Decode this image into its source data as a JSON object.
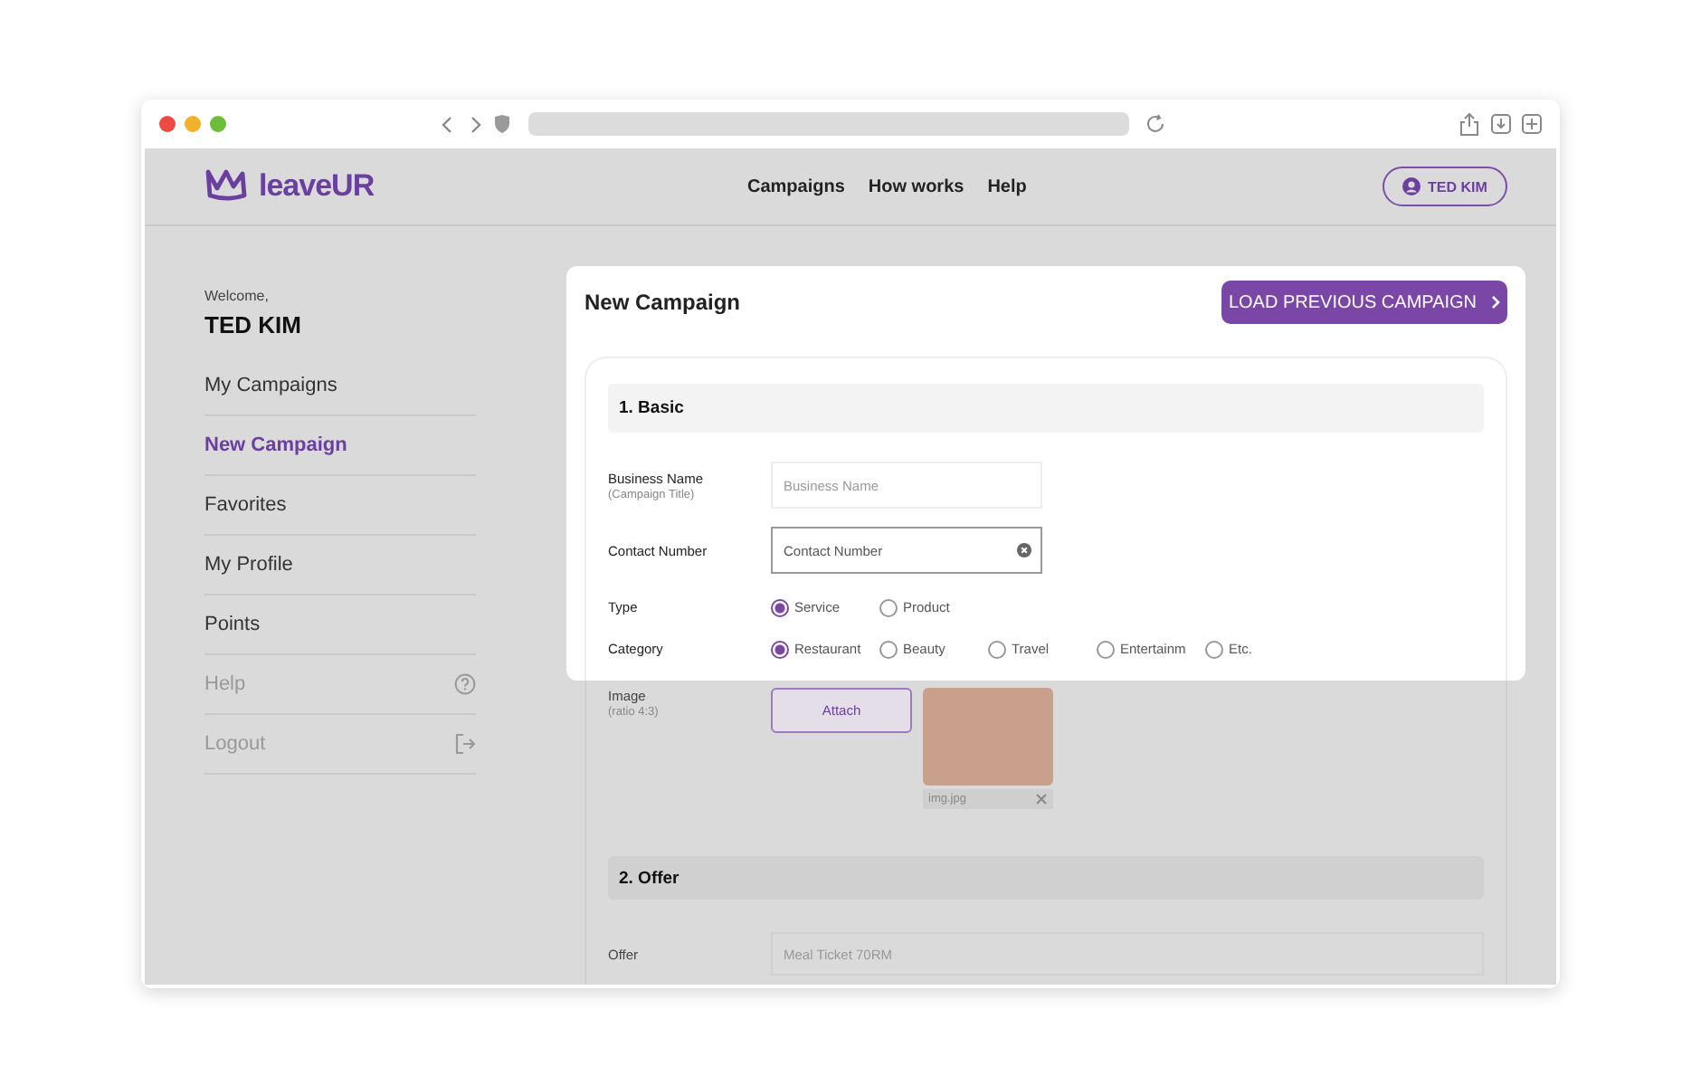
{
  "header": {
    "logo": "leaveUR",
    "nav": [
      "Campaigns",
      "How works",
      "Help"
    ],
    "user_button": "TED KIM"
  },
  "sidebar": {
    "welcome": "Welcome,",
    "user_name": "TED KIM",
    "items": [
      {
        "label": "My Campaigns",
        "kind": "nav",
        "selected": false
      },
      {
        "label": "New Campaign",
        "kind": "nav",
        "selected": true
      },
      {
        "label": "Favorites",
        "kind": "nav",
        "selected": false
      },
      {
        "label": "My Profile",
        "kind": "nav",
        "selected": false
      },
      {
        "label": "Points",
        "kind": "nav",
        "selected": false
      },
      {
        "label": "Help",
        "kind": "help",
        "selected": false
      },
      {
        "label": "Logout",
        "kind": "logout",
        "selected": false
      }
    ]
  },
  "panel": {
    "title": "New Campaign",
    "load_button": "LOAD PREVIOUS CAMPAIGN",
    "sections": [
      {
        "title": "1. Basic",
        "fields": [
          {
            "kind": "text",
            "label": "Business Name",
            "sublabel": "(Campaign Title)",
            "placeholder": "Business Name",
            "focused": false,
            "highlighted": true
          },
          {
            "kind": "text",
            "label": "Contact Number",
            "placeholder": "Contact Number",
            "focused": true,
            "highlighted": true
          },
          {
            "kind": "radio",
            "label": "Type",
            "highlighted": true,
            "options": [
              {
                "label": "Service",
                "selected": true
              },
              {
                "label": "Product",
                "selected": false
              }
            ]
          },
          {
            "kind": "radio",
            "label": "Category",
            "highlighted": true,
            "options": [
              {
                "label": "Restaurant",
                "selected": true
              },
              {
                "label": "Beauty",
                "selected": false
              },
              {
                "label": "Travel",
                "selected": false
              },
              {
                "label": "Entertainm",
                "selected": false
              },
              {
                "label": "Etc.",
                "selected": false
              }
            ]
          },
          {
            "kind": "image",
            "label": "Image",
            "sublabel": "(ratio 4:3)",
            "button": "Attach",
            "file_name": "img.jpg",
            "highlighted": false
          }
        ]
      },
      {
        "title": "2. Offer",
        "fields": [
          {
            "kind": "wide",
            "label": "Offer",
            "placeholder": "Meal Ticket 70RM",
            "focused": false,
            "highlighted": false
          }
        ]
      }
    ]
  }
}
